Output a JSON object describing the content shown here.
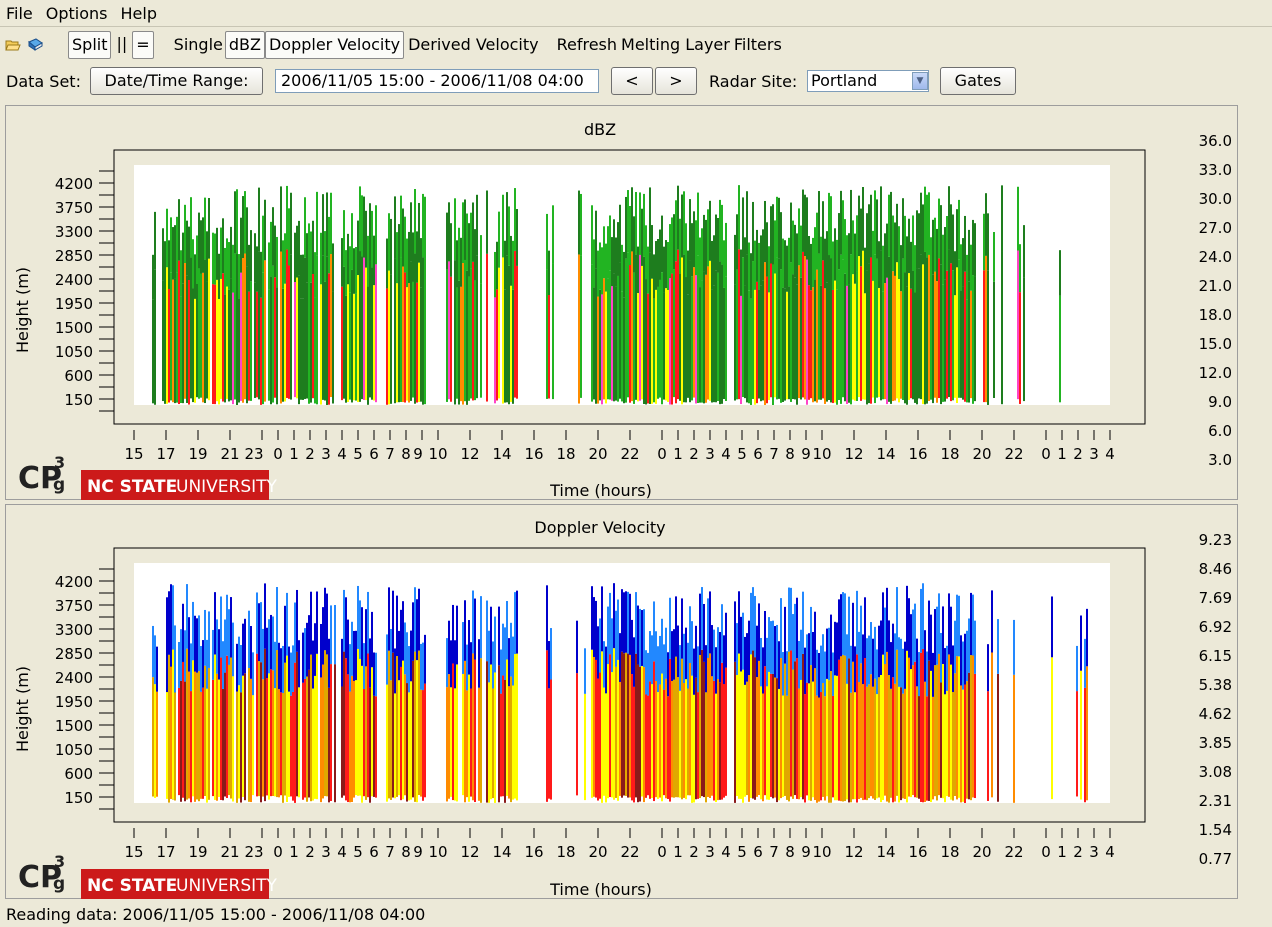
{
  "menu": [
    "File",
    "Options",
    "Help"
  ],
  "toolbar": {
    "split": "Split",
    "pause": "||",
    "equal": "=",
    "single": "Single",
    "dbz": "dBZ",
    "doppler": "Doppler Velocity",
    "derived": "Derived Velocity",
    "refresh": "Refresh",
    "melting": "Melting Layer",
    "filters": "Filters"
  },
  "dataset": {
    "label": "Data Set:",
    "range_button": "Date/Time Range:",
    "range_value": "2006/11/05 15:00 - 2006/11/08 04:00",
    "prev": "<",
    "next": ">",
    "radar_label": "Radar Site:",
    "radar_value": "Portland",
    "gates": "Gates"
  },
  "logo": {
    "cp3_main": "CP",
    "cp3_sup": "3",
    "cp3_sub": "g",
    "ncstate": "NC STATE",
    "university": "UNIVERSITY"
  },
  "time_ticks": [
    "15",
    "17",
    "19",
    "21",
    "23",
    "0",
    "1",
    "2",
    "3",
    "4",
    "5",
    "6",
    "7",
    "8",
    "9",
    "10",
    "12",
    "14",
    "16",
    "18",
    "20",
    "22",
    "0",
    "1",
    "2",
    "3",
    "4",
    "5",
    "6",
    "7",
    "8",
    "9",
    "10",
    "12",
    "14",
    "16",
    "18",
    "20",
    "22",
    "0",
    "1",
    "2",
    "3",
    "4"
  ],
  "height_ticks": [
    "4200",
    "3750",
    "3300",
    "2850",
    "2400",
    "1950",
    "1500",
    "1050",
    "600",
    "150"
  ],
  "panels": [
    {
      "title": "dBZ",
      "ylabel": "Height (m)",
      "xlabel": "Time (hours)",
      "scale_labels": [
        "36.0",
        "33.0",
        "30.0",
        "27.0",
        "24.0",
        "21.0",
        "18.0",
        "15.0",
        "12.0",
        "9.0",
        "6.0",
        "3.0"
      ]
    },
    {
      "title": "Doppler Velocity",
      "ylabel": "Height (m)",
      "xlabel": "Time (hours)",
      "scale_labels": [
        "9.23",
        "8.46",
        "7.69",
        "6.92",
        "6.15",
        "5.38",
        "4.62",
        "3.85",
        "3.08",
        "2.31",
        "1.54",
        "0.77"
      ]
    }
  ],
  "colors": {
    "scale": [
      "#8a1ab0",
      "#ff44c8",
      "#8a1a1a",
      "#ff1a1a",
      "#ff8c00",
      "#e0a800",
      "#ffff00",
      "#1e7d1e",
      "#22b422",
      "#00c800",
      "#0000cc",
      "#2288ff",
      "#22d8e0"
    ]
  },
  "status": "Reading data: 2006/11/05 15:00 - 2006/11/08 04:00"
}
